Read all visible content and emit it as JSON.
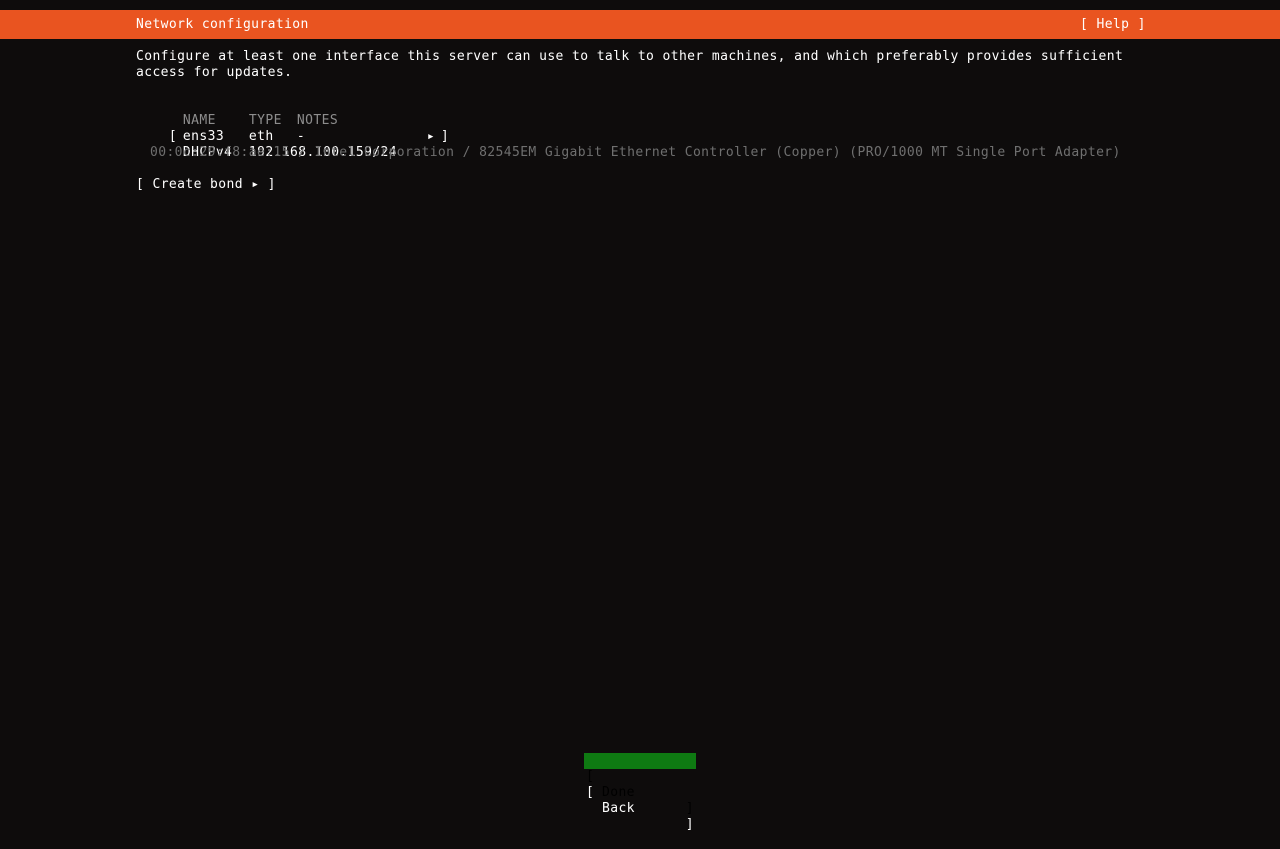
{
  "header": {
    "title": "Network configuration",
    "help_label": "Help",
    "bracket_open": "[",
    "bracket_close": "]",
    "bg_color": "#e95420",
    "fg_color": "#ffffff"
  },
  "description": {
    "line1": "Configure at least one interface this server can use to talk to other machines, and which preferably provides sufficient",
    "line2": "access for updates."
  },
  "interfaces_table": {
    "columns": [
      "NAME",
      "TYPE",
      "NOTES"
    ],
    "rows": [
      {
        "bracket_open": "[",
        "name": "ens33",
        "type": "eth",
        "notes": "-",
        "arrow": "▸",
        "bracket_close": "]",
        "detail_protocol": "DHCPv4",
        "detail_address": "192.168.100.159/24",
        "hardware": "00:0c:29:f8:ae:15 / Intel Corporation / 82545EM Gigabit Ethernet Controller (Copper) (PRO/1000 MT Single Port Adapter)"
      }
    ]
  },
  "create_bond": {
    "bracket_open": "[",
    "label": "Create bond",
    "arrow": "▸",
    "bracket_close": "]"
  },
  "footer": {
    "buttons": [
      {
        "label": "Done",
        "bracket_open": "[",
        "bracket_close": "]",
        "selected": true,
        "bg_color": "#0e7a12",
        "fg_color": "#000000"
      },
      {
        "label": "Back",
        "bracket_open": "[",
        "bracket_close": "]",
        "selected": false,
        "bg_color": "#0e0c0c",
        "fg_color": "#ffffff"
      }
    ]
  },
  "theme": {
    "background": "#0e0c0c",
    "foreground": "#ffffff",
    "muted": "#8d8d8d",
    "dim": "#6f6f6f",
    "accent": "#e95420",
    "highlight": "#0e7a12"
  }
}
